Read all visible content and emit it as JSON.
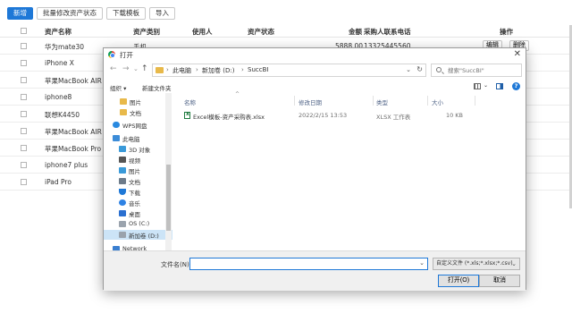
{
  "toolbar": {
    "add": "新增",
    "batch_status": "批量修改资产状态",
    "download_template": "下载模板",
    "import": "导入"
  },
  "table": {
    "headers": {
      "name": "资产名称",
      "category": "资产类别",
      "user": "使用人",
      "status": "资产状态",
      "amount": "金额",
      "purchaser_phone": "采购人联系电话",
      "action": "操作"
    },
    "rows": [
      {
        "name": "华为mate30",
        "category": "手机",
        "amount": "5888.00",
        "phone": "13325445560",
        "edit": "编辑",
        "delete": "删除"
      },
      {
        "name": "iPhone X"
      },
      {
        "name": "苹果MacBook AIR"
      },
      {
        "name": "iphone8"
      },
      {
        "name": "联想K4450"
      },
      {
        "name": "苹果MacBook AIR"
      },
      {
        "name": "苹果MacBook Pro"
      },
      {
        "name": "iphone7 plus"
      },
      {
        "name": "iPad Pro"
      }
    ]
  },
  "dialog": {
    "title": "打开",
    "close": "✕",
    "nav": {
      "back": "←",
      "forward": "→",
      "dropdown": "⌄",
      "up": "↑"
    },
    "address": {
      "crumbs": [
        "此电脑",
        "新加卷 (D:)",
        "SuccBI"
      ],
      "separator": "›",
      "dropdown": "⌄",
      "refresh": "↻"
    },
    "search_placeholder": "搜索\"SuccBI\"",
    "commands": {
      "organize": "组织 ▾",
      "new_folder": "新建文件夹",
      "help": "?"
    },
    "nav_pane": [
      {
        "label": "图片",
        "icon": "folder-icon",
        "ico": "folder"
      },
      {
        "label": "文档",
        "icon": "folder-icon",
        "ico": "folder"
      },
      {
        "label": "WPS网盘",
        "icon": "cloud-icon",
        "ico": "cloud"
      },
      {
        "label": "此电脑",
        "icon": "computer-icon",
        "ico": "pc"
      },
      {
        "label": "3D 对象",
        "icon": "3d-objects-icon",
        "ico": "cube"
      },
      {
        "label": "视频",
        "icon": "video-icon",
        "ico": "video"
      },
      {
        "label": "图片",
        "icon": "pictures-icon",
        "ico": "pic"
      },
      {
        "label": "文档",
        "icon": "documents-icon",
        "ico": "doc"
      },
      {
        "label": "下载",
        "icon": "download-icon",
        "ico": "dl"
      },
      {
        "label": "音乐",
        "icon": "music-icon",
        "ico": "music"
      },
      {
        "label": "桌面",
        "icon": "desktop-icon",
        "ico": "desk"
      },
      {
        "label": "OS (C:)",
        "icon": "drive-icon",
        "ico": "drive"
      },
      {
        "label": "新加卷 (D:)",
        "icon": "drive-icon",
        "ico": "drive",
        "selected": true
      },
      {
        "label": "Network",
        "icon": "network-icon",
        "ico": "netw"
      }
    ],
    "columns": {
      "name": "名称",
      "modified": "修改日期",
      "type": "类型",
      "size": "大小",
      "sort_caret": "^"
    },
    "files": [
      {
        "name": "Excel模板-资产采购表.xlsx",
        "modified": "2022/2/15 13:53",
        "type": "XLSX 工作表",
        "size": "10 KB"
      }
    ],
    "filename_label": "文件名(N):",
    "filename_value": "",
    "filter": "自定义文件 (*.xls;*.xlsx;*.csv)",
    "open": "打开(O)",
    "cancel": "取消"
  }
}
